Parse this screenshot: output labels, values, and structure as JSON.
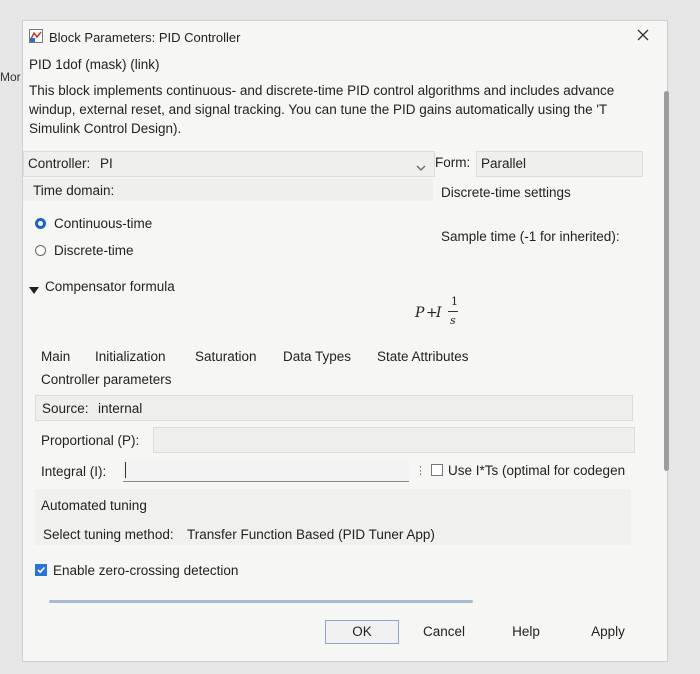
{
  "window": {
    "title": "Block Parameters: PID Controller",
    "side_text": "Mor"
  },
  "header": {
    "block_name": "PID 1dof (mask) (link)",
    "description_lines": [
      "This block implements continuous- and discrete-time PID control algorithms and includes advance",
      "windup, external reset, and signal tracking. You can tune the PID gains automatically using the 'T",
      "Simulink Control Design)."
    ]
  },
  "controller": {
    "label": "Controller:",
    "value": "PI"
  },
  "form": {
    "label": "Form:",
    "value": "Parallel"
  },
  "time_domain": {
    "label": "Time domain:",
    "options": [
      "Continuous-time",
      "Discrete-time"
    ],
    "selected": "Continuous-time"
  },
  "discrete_settings": {
    "heading": "Discrete-time settings",
    "sample_time_label": "Sample time (-1 for inherited):"
  },
  "compensator": {
    "label": "Compensator formula",
    "formula": {
      "p": "P",
      "plus": "+",
      "i": "I",
      "num": "1",
      "den": "s"
    }
  },
  "tabs": [
    "Main",
    "Initialization",
    "Saturation",
    "Data Types",
    "State Attributes"
  ],
  "params": {
    "section_title": "Controller parameters",
    "source_label": "Source:",
    "source_value": "internal",
    "proportional_label": "Proportional (P):",
    "integral_label": "Integral (I):",
    "integral_value": "",
    "use_its_label": "Use I*Ts (optimal for codegen",
    "use_its_checked": false
  },
  "tuning": {
    "title": "Automated tuning",
    "method_label": "Select tuning method:",
    "method_value": "Transfer Function Based (PID Tuner App)"
  },
  "zero_crossing": {
    "label": "Enable zero-crossing detection",
    "checked": true
  },
  "buttons": {
    "ok": "OK",
    "cancel": "Cancel",
    "help": "Help",
    "apply": "Apply"
  },
  "colors": {
    "accent": "#1a63c9",
    "dialog_bg": "#f6f6f5"
  }
}
